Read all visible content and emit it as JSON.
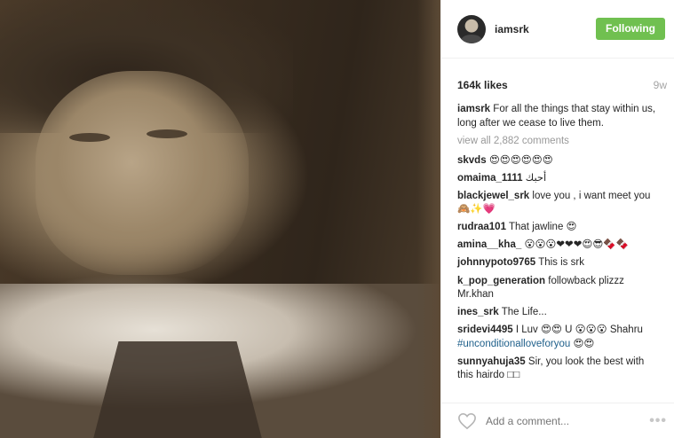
{
  "post": {
    "username": "iamsrk",
    "follow_label": "Following",
    "likes": "164k likes",
    "time_ago": "9w",
    "caption": {
      "user": "iamsrk",
      "text": "For all the things that stay within us, long after we cease to live them."
    },
    "view_all": "view all 2,882 comments",
    "comments": [
      {
        "user": "skvds",
        "text": "😍😍😍😍😍😍"
      },
      {
        "user": "omaima_1111",
        "text": "أحبك"
      },
      {
        "user": "blackjewel_srk",
        "text": "love you , i want meet you 🙈✨💗"
      },
      {
        "user": "rudraa101",
        "text": "That jawline 😍"
      },
      {
        "user": "amina__kha_",
        "text": "😮😮😮❤❤❤😍😎🍫🍫"
      },
      {
        "user": "johnnypoto9765",
        "text": "This is srk"
      },
      {
        "user": "k_pop_generation",
        "text": "followback plizzz Mr.khan"
      },
      {
        "user": "ines_srk",
        "text": "The Life..."
      },
      {
        "user": "sridevi4495",
        "text": "I Luv 😍😍 U 😮😮😮 Shahru",
        "hashtag": "#unconditionalloveforyou",
        "after": "😍😍"
      },
      {
        "user": "sunnyahuja35",
        "text": "Sir, you look the best with this hairdo □□"
      }
    ],
    "add_comment_placeholder": "Add a comment...",
    "more_label": "•••"
  },
  "colors": {
    "follow_button": "#70c050",
    "hashtag": "#1e5f8a",
    "muted": "#999999"
  },
  "icons": {
    "like": "heart-outline-icon",
    "more": "ellipsis-icon"
  }
}
